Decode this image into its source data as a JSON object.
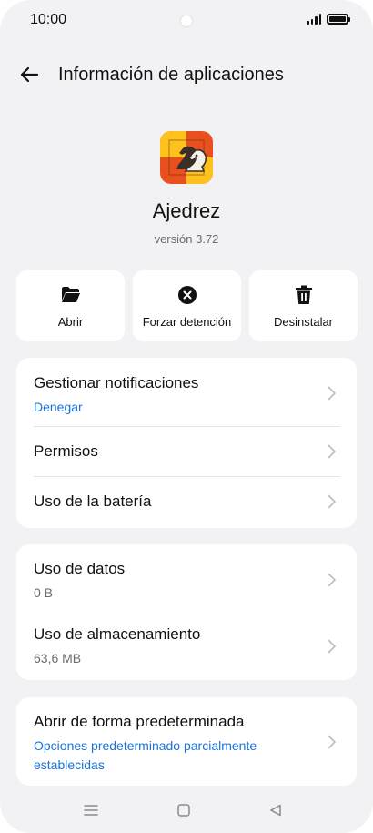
{
  "status_bar": {
    "time": "10:00"
  },
  "header": {
    "title": "Información de aplicaciones"
  },
  "app": {
    "name": "Ajedrez",
    "version": "versión 3.72"
  },
  "actions": [
    {
      "label": "Abrir",
      "icon": "folder-open-icon"
    },
    {
      "label": "Forzar detención",
      "icon": "stop-circle-icon"
    },
    {
      "label": "Desinstalar",
      "icon": "trash-icon"
    }
  ],
  "settings": {
    "notifications": {
      "title": "Gestionar notificaciones",
      "value": "Denegar"
    },
    "permissions": {
      "title": "Permisos"
    },
    "battery": {
      "title": "Uso de la batería"
    },
    "data_usage": {
      "title": "Uso de datos",
      "value": "0 B"
    },
    "storage": {
      "title": "Uso de almacenamiento",
      "value": "63,6 MB"
    },
    "default_open": {
      "title": "Abrir de forma predeterminada",
      "value_line1": "Opciones predeterminado parcialmente",
      "value_line2": "establecidas"
    }
  },
  "colors": {
    "accent_blue": "#1a73d9",
    "background": "#f2f2f4",
    "card": "#ffffff"
  }
}
